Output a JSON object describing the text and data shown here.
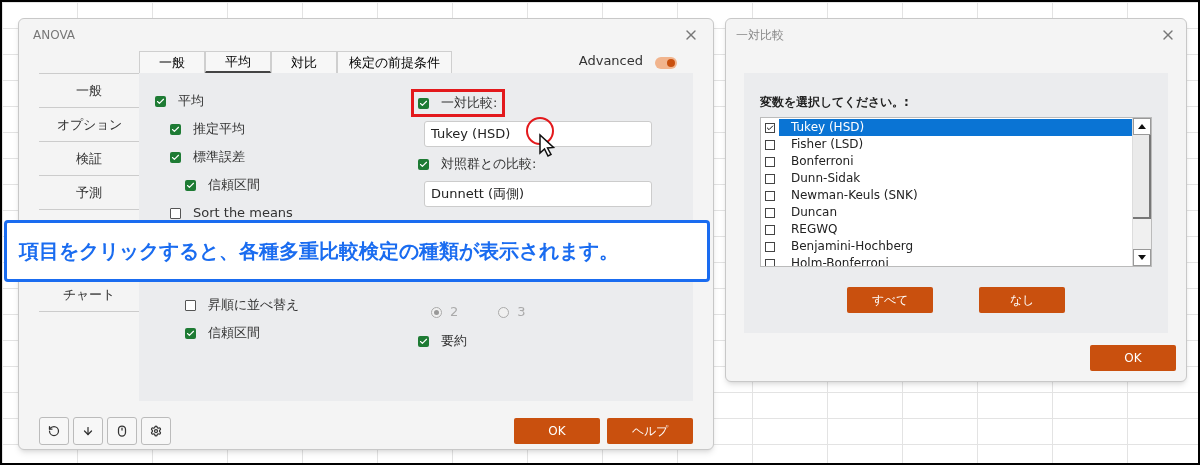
{
  "anova": {
    "title": "ANOVA",
    "tabs": [
      {
        "label": "一般",
        "selected": false
      },
      {
        "label": "平均",
        "selected": true
      },
      {
        "label": "対比",
        "selected": false
      },
      {
        "label": "検定の前提条件",
        "selected": false
      }
    ],
    "advanced": {
      "label": "Advanced",
      "on": true
    },
    "sidebar": {
      "items": [
        {
          "label": "一般"
        },
        {
          "label": "オプション"
        },
        {
          "label": "検証"
        },
        {
          "label": "予測"
        },
        {
          "label": "チャート"
        }
      ]
    },
    "means": {
      "label": "平均",
      "checked": true,
      "children": [
        {
          "label": "推定平均",
          "checked": true
        },
        {
          "label": "標準誤差",
          "checked": true,
          "children": [
            {
              "label": "信頼区間",
              "checked": true
            }
          ]
        },
        {
          "label": "Sort the means",
          "checked": false,
          "children": [
            {
              "label": "昇順に並べ替え",
              "checked": false
            },
            {
              "label": "信頼区間",
              "checked": true
            }
          ]
        }
      ]
    },
    "pairwise": {
      "label": "一対比較:",
      "checked": true,
      "highlighted": true,
      "value": "Tukey (HSD)"
    },
    "control": {
      "label": "対照群との比較:",
      "checked": true,
      "value": "Dunnett (両側)"
    },
    "radios": {
      "disabled": true,
      "options": [
        {
          "label": "2",
          "selected": true
        },
        {
          "label": "3",
          "selected": false
        }
      ]
    },
    "summary": {
      "label": "要約",
      "checked": true
    },
    "buttons": [
      "OK",
      "ヘルプ"
    ]
  },
  "pairwise_dialog": {
    "title": "一対比較",
    "prompt": "変数を選択してください。:",
    "items": [
      {
        "label": "Tukey (HSD)",
        "checked": true,
        "selected": true
      },
      {
        "label": "Fisher (LSD)",
        "checked": false,
        "selected": false
      },
      {
        "label": "Bonferroni",
        "checked": false,
        "selected": false
      },
      {
        "label": "Dunn-Sidak",
        "checked": false,
        "selected": false
      },
      {
        "label": "Newman-Keuls (SNK)",
        "checked": false,
        "selected": false
      },
      {
        "label": "Duncan",
        "checked": false,
        "selected": false
      },
      {
        "label": "REGWQ",
        "checked": false,
        "selected": false
      },
      {
        "label": "Benjamini-Hochberg",
        "checked": false,
        "selected": false
      },
      {
        "label": "Holm-Bonferroni",
        "checked": false,
        "selected": false
      }
    ],
    "buttons": [
      "すべて",
      "なし"
    ],
    "ok": "OK"
  },
  "banner": "項目をクリックすると、各種多重比較検定の種類が表示されます。"
}
